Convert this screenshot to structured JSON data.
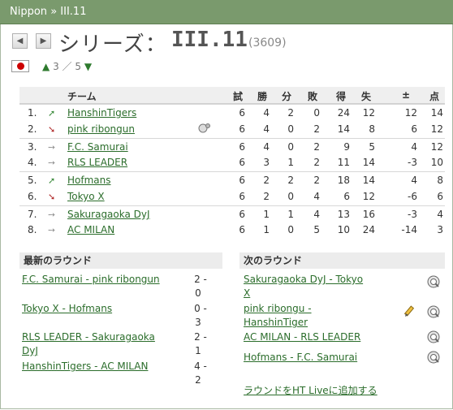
{
  "breadcrumb": {
    "parent": "Nippon",
    "separator": "»",
    "current": "III.11"
  },
  "header": {
    "prefix": "シリーズ：",
    "name": "III.11",
    "id": "(3609)",
    "level_current": "3",
    "level_sep": "／",
    "level_total": "5"
  },
  "table": {
    "columns": {
      "team": "チーム",
      "played": "試",
      "won": "勝",
      "drawn": "分",
      "lost": "敗",
      "goals_for": "得",
      "goals_against": "失",
      "goal_diff": "±",
      "points": "点"
    },
    "rows": [
      {
        "pos": "1.",
        "trend": "up",
        "team": "HanshinTigers",
        "p": "6",
        "w": "4",
        "d": "2",
        "l": "0",
        "gf": "24",
        "ga": "12",
        "gd": "12",
        "pts": "14"
      },
      {
        "pos": "2.",
        "trend": "down",
        "team": "pink ribongun",
        "p": "6",
        "w": "4",
        "d": "0",
        "l": "2",
        "gf": "14",
        "ga": "8",
        "gd": "6",
        "pts": "12",
        "icon": "match-icon"
      },
      {
        "pos": "3.",
        "trend": "same",
        "team": "F.C. Samurai",
        "p": "6",
        "w": "4",
        "d": "0",
        "l": "2",
        "gf": "9",
        "ga": "5",
        "gd": "4",
        "pts": "12"
      },
      {
        "pos": "4.",
        "trend": "same",
        "team": "RLS LEADER",
        "p": "6",
        "w": "3",
        "d": "1",
        "l": "2",
        "gf": "11",
        "ga": "14",
        "gd": "-3",
        "pts": "10"
      },
      {
        "pos": "5.",
        "trend": "up",
        "team": "Hofmans",
        "p": "6",
        "w": "2",
        "d": "2",
        "l": "2",
        "gf": "18",
        "ga": "14",
        "gd": "4",
        "pts": "8"
      },
      {
        "pos": "6.",
        "trend": "down",
        "team": "Tokyo X",
        "p": "6",
        "w": "2",
        "d": "0",
        "l": "4",
        "gf": "6",
        "ga": "12",
        "gd": "-6",
        "pts": "6"
      },
      {
        "pos": "7.",
        "trend": "same",
        "team": "Sakuragaoka DyJ",
        "p": "6",
        "w": "1",
        "d": "1",
        "l": "4",
        "gf": "13",
        "ga": "16",
        "gd": "-3",
        "pts": "4"
      },
      {
        "pos": "8.",
        "trend": "same",
        "team": "AC MILAN",
        "p": "6",
        "w": "1",
        "d": "0",
        "l": "5",
        "gf": "10",
        "ga": "24",
        "gd": "-14",
        "pts": "3"
      }
    ]
  },
  "latest": {
    "title": "最新のラウンド",
    "matches": [
      {
        "line1": "F.C. Samurai - pink ribongun",
        "line2": "",
        "h": "2 -",
        "a": "0"
      },
      {
        "line1": "Tokyo X - Hofmans",
        "line2": "",
        "h": "0 -",
        "a": "3"
      },
      {
        "line1": "RLS LEADER - Sakuragaoka",
        "line2": "DyJ",
        "h": "2 -",
        "a": "1"
      },
      {
        "line1": "HanshinTigers - AC MILAN",
        "line2": "",
        "h": "4 -",
        "a": "2"
      }
    ]
  },
  "next": {
    "title": "次のラウンド",
    "matches": [
      {
        "line1": "Sakuragaoka DyJ - Tokyo",
        "line2": "X"
      },
      {
        "line1": "pink ribongu -",
        "line2": "HanshinTiger"
      },
      {
        "line1": "AC MILAN - RLS LEADER",
        "line2": ""
      },
      {
        "line1": "Hofmans - F.C. Samurai",
        "line2": ""
      }
    ],
    "add_live": "ラウンドをHT Liveに追加する"
  }
}
